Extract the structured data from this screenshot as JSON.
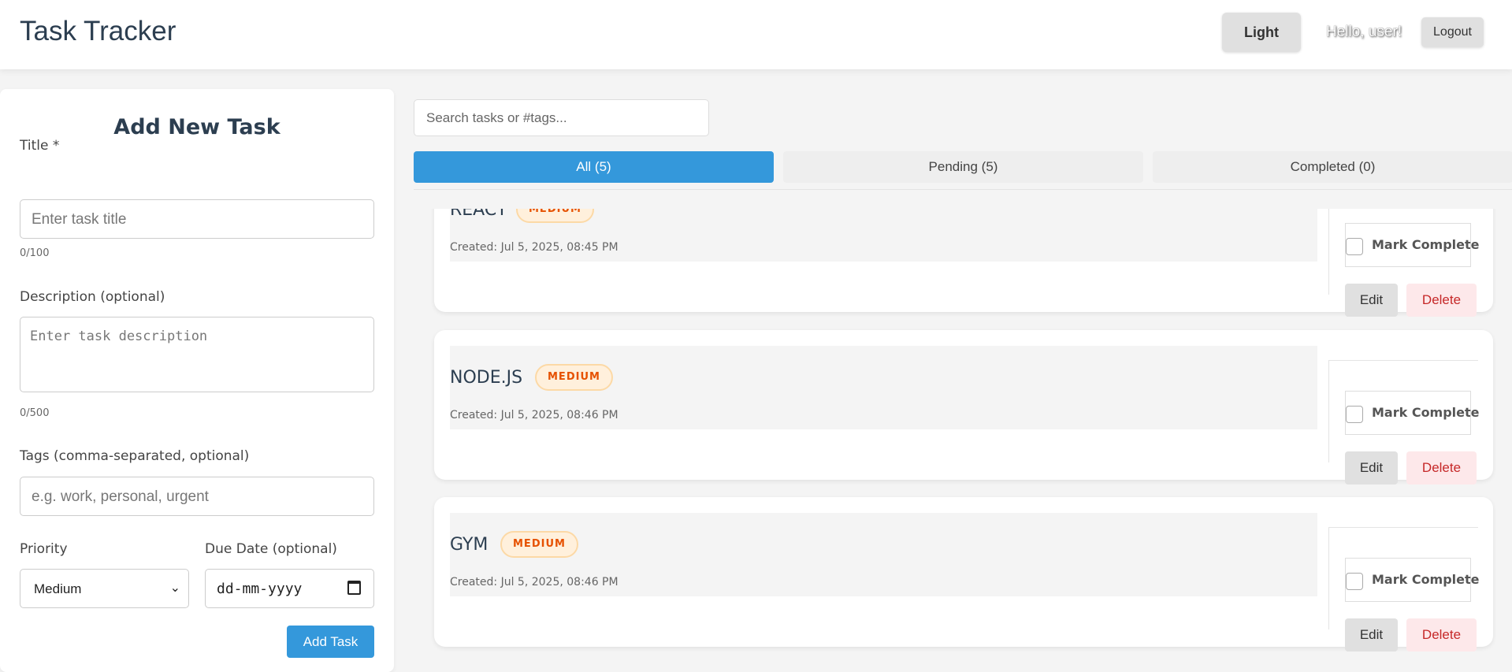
{
  "header": {
    "title": "Task Tracker",
    "theme_button": "Light",
    "greeting": "Hello, user!",
    "logout": "Logout"
  },
  "form": {
    "heading": "Add New Task",
    "title_label": "Title *",
    "title_placeholder": "Enter task title",
    "title_count": "0/100",
    "description_label": "Description (optional)",
    "description_placeholder": "Enter task description",
    "description_count": "0/500",
    "tags_label": "Tags (comma-separated, optional)",
    "tags_placeholder": "e.g. work, personal, urgent",
    "priority_label": "Priority",
    "priority_value": "Medium",
    "due_label": "Due Date (optional)",
    "due_placeholder": "dd-mm-yyyy",
    "submit": "Add Task"
  },
  "search": {
    "placeholder": "Search tasks or #tags..."
  },
  "tabs": [
    {
      "label": "All (5)",
      "active": true
    },
    {
      "label": "Pending (5)"
    },
    {
      "label": "Completed (0)"
    }
  ],
  "tasks": [
    {
      "name": "REACT",
      "priority": "MEDIUM",
      "created": "Created: Jul 5, 2025, 08:45 PM",
      "mark": "Mark Complete",
      "edit": "Edit",
      "delete": "Delete"
    },
    {
      "name": "NODE.JS",
      "priority": "MEDIUM",
      "created": "Created: Jul 5, 2025, 08:46 PM",
      "mark": "Mark Complete",
      "edit": "Edit",
      "delete": "Delete"
    },
    {
      "name": "GYM",
      "priority": "MEDIUM",
      "created": "Created: Jul 5, 2025, 08:46 PM",
      "mark": "Mark Complete",
      "edit": "Edit",
      "delete": "Delete"
    }
  ],
  "colors": {
    "accent": "#3498db",
    "badge_text": "#e65100",
    "delete_text": "#c62828"
  }
}
